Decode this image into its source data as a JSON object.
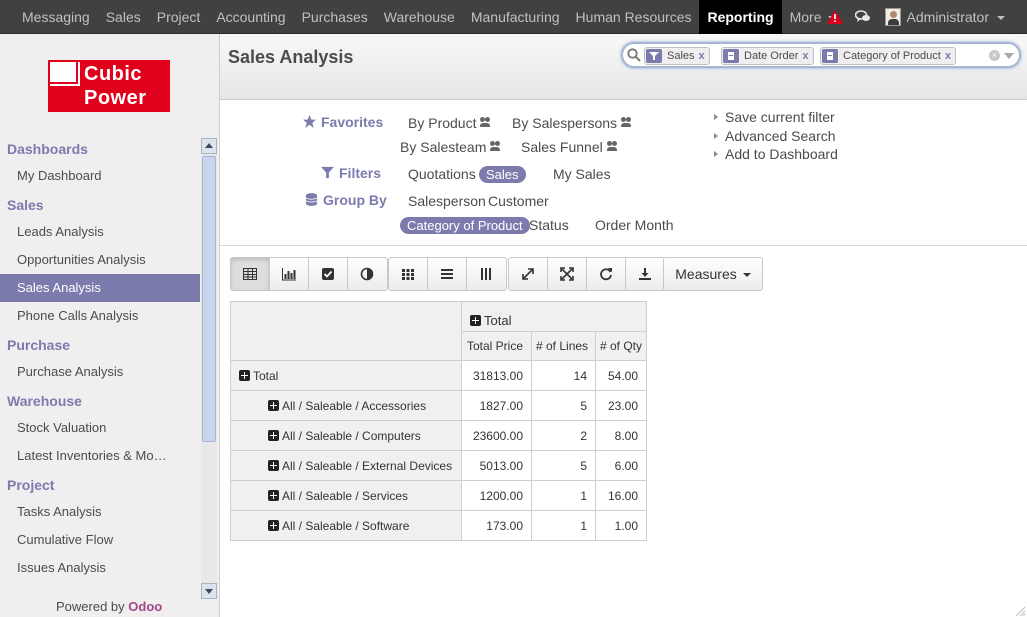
{
  "topbar": {
    "menu": [
      {
        "label": "Messaging",
        "active": false
      },
      {
        "label": "Sales",
        "active": false
      },
      {
        "label": "Project",
        "active": false
      },
      {
        "label": "Accounting",
        "active": false
      },
      {
        "label": "Purchases",
        "active": false
      },
      {
        "label": "Warehouse",
        "active": false
      },
      {
        "label": "Manufacturing",
        "active": false
      },
      {
        "label": "Human Resources",
        "active": false
      },
      {
        "label": "Reporting",
        "active": true
      }
    ],
    "more_label": "More",
    "user_name": "Administrator",
    "icons": [
      "alert-triangle-icon",
      "chat-bubbles-icon"
    ],
    "alert_color": "#d9001b"
  },
  "logo": {
    "line1": "Cubic",
    "line2": "Power",
    "color": "#e0001b"
  },
  "sidebar": {
    "sections": [
      {
        "title": "Dashboards",
        "items": [
          {
            "label": "My Dashboard",
            "active": false
          }
        ]
      },
      {
        "title": "Sales",
        "items": [
          {
            "label": "Leads Analysis",
            "active": false
          },
          {
            "label": "Opportunities Analysis",
            "active": false
          },
          {
            "label": "Sales Analysis",
            "active": true
          },
          {
            "label": "Phone Calls Analysis",
            "active": false
          }
        ]
      },
      {
        "title": "Purchase",
        "items": [
          {
            "label": "Purchase Analysis",
            "active": false
          }
        ]
      },
      {
        "title": "Warehouse",
        "items": [
          {
            "label": "Stock Valuation",
            "active": false
          },
          {
            "label": "Latest Inventories & Mo…",
            "active": false
          }
        ]
      },
      {
        "title": "Project",
        "items": [
          {
            "label": "Tasks Analysis",
            "active": false
          },
          {
            "label": "Cumulative Flow",
            "active": false
          },
          {
            "label": "Issues Analysis",
            "active": false
          }
        ]
      }
    ],
    "powered_by_prefix": "Powered by",
    "powered_by_brand": "Odoo"
  },
  "page": {
    "title": "Sales Analysis",
    "accent": "#7c7bad"
  },
  "search": {
    "facets": [
      {
        "label": "Sales",
        "icon": "filter-icon"
      },
      {
        "label": "Date Order",
        "icon": "group-by-icon"
      },
      {
        "label": "Category of Product",
        "icon": "group-by-icon"
      }
    ],
    "remove_label": "x"
  },
  "drawer": {
    "favorites_label": "Favorites",
    "favorites": [
      "By Product",
      "By Salespersons",
      "By Salesteam",
      "Sales Funnel"
    ],
    "filters_label": "Filters",
    "filters": [
      {
        "label": "Quotations",
        "selected": false
      },
      {
        "label": "Sales",
        "selected": true
      },
      {
        "label": "My Sales",
        "selected": false
      }
    ],
    "groupby_label": "Group By",
    "groupby": [
      {
        "label": "Salesperson",
        "selected": false
      },
      {
        "label": "Customer",
        "selected": false
      },
      {
        "label": "Category of Product",
        "selected": true
      },
      {
        "label": "Status",
        "selected": false
      },
      {
        "label": "Order Month",
        "selected": false
      }
    ],
    "actions": [
      "Save current filter",
      "Advanced Search",
      "Add to Dashboard"
    ]
  },
  "toolbar": {
    "mode_buttons": [
      "table-icon",
      "bar-chart-icon",
      "checkbox-icon",
      "contrast-icon"
    ],
    "layout_buttons": [
      "grid-icon",
      "rows-icon",
      "columns-icon"
    ],
    "action_buttons": [
      "expand-icon",
      "fullscreen-icon",
      "refresh-icon",
      "download-icon"
    ],
    "measures_label": "Measures"
  },
  "pivot": {
    "col_header": "Total",
    "measures": [
      "Total Price",
      "# of Lines",
      "# of Qty"
    ],
    "total_row": {
      "label": "Total",
      "values": [
        "31813.00",
        "14",
        "54.00"
      ]
    },
    "rows": [
      {
        "label": "All / Saleable / Accessories",
        "values": [
          "1827.00",
          "5",
          "23.00"
        ]
      },
      {
        "label": "All / Saleable / Computers",
        "values": [
          "23600.00",
          "2",
          "8.00"
        ]
      },
      {
        "label": "All / Saleable / External Devices",
        "values": [
          "5013.00",
          "5",
          "6.00"
        ]
      },
      {
        "label": "All / Saleable / Services",
        "values": [
          "1200.00",
          "1",
          "16.00"
        ]
      },
      {
        "label": "All / Saleable / Software",
        "values": [
          "173.00",
          "1",
          "1.00"
        ]
      }
    ]
  }
}
